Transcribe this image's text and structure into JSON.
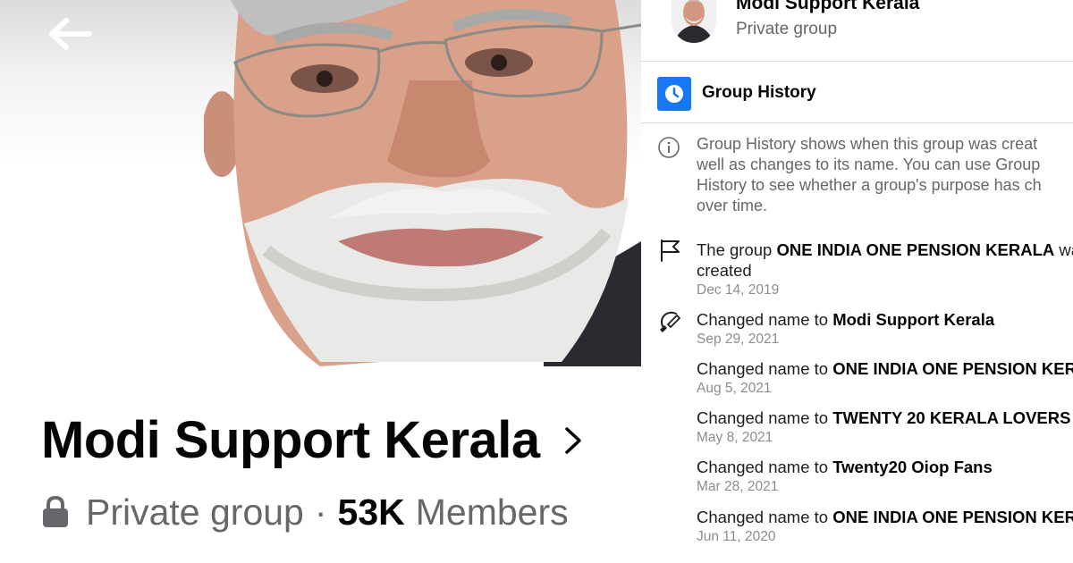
{
  "cover": {
    "photo_subject": "man-portrait"
  },
  "header": {
    "back_icon": "arrow-left-icon"
  },
  "group": {
    "name": "Modi Support Kerala",
    "privacy": "Private group",
    "separator": "·",
    "members_count": "53K",
    "members_label": "Members"
  },
  "panel": {
    "group_name": "Modi Support Kerala",
    "privacy": "Private group",
    "section_title": "Group History",
    "info_lines": [
      "Group History shows when this group was creat",
      "well as changes to its name. You can use Group",
      "History to see whether a group's purpose has ch",
      "over time."
    ],
    "events": [
      {
        "icon": "flag-icon",
        "prefix": "The group ",
        "name": "ONE INDIA ONE PENSION KERALA",
        "suffix": " wa",
        "line2": "created",
        "date": "Dec 14, 2019"
      },
      {
        "icon": "rename-icon",
        "prefix": "Changed name to ",
        "name": "Modi Support Kerala",
        "suffix": "",
        "date": "Sep 29, 2021"
      },
      {
        "prefix": "Changed name to ",
        "name": "ONE INDIA ONE PENSION KER",
        "suffix": "",
        "date": "Aug 5, 2021"
      },
      {
        "prefix": "Changed name to ",
        "name": "TWENTY 20 KERALA LOVERS",
        "suffix": "",
        "date": "May 8, 2021"
      },
      {
        "prefix": "Changed name to ",
        "name": "Twenty20 Oiop Fans",
        "suffix": "",
        "date": "Mar 28, 2021"
      },
      {
        "prefix": "Changed name to ",
        "name": "ONE INDIA ONE PENSION KER",
        "suffix": "",
        "date": "Jun 11, 2020"
      }
    ]
  },
  "colors": {
    "accent": "#1877f2",
    "text_primary": "#050505",
    "text_secondary": "#65676b",
    "text_tertiary": "#8a8d91",
    "divider": "#dadde1"
  }
}
